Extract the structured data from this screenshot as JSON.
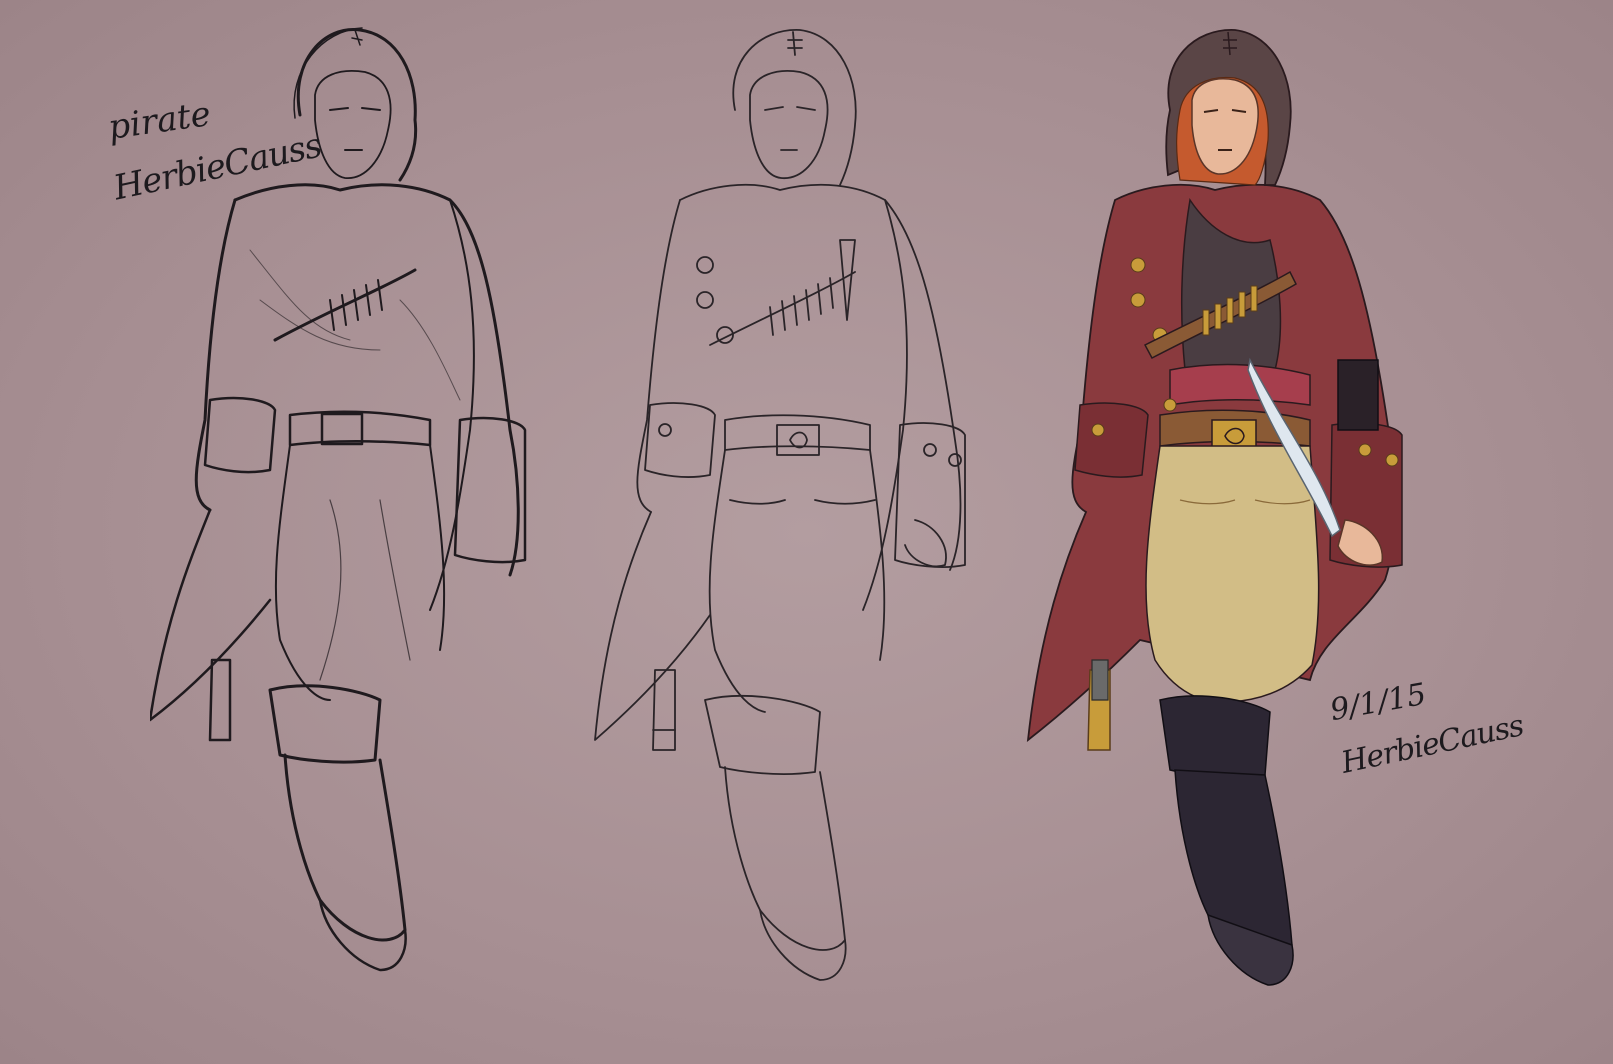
{
  "artwork": {
    "background_color": "#a8919a",
    "panels": [
      {
        "stage": "sketch",
        "stroke": "#1f1a1e"
      },
      {
        "stage": "lineart",
        "stroke": "#2a2428"
      },
      {
        "stage": "color",
        "palette": {
          "coat": "#8a3a3e",
          "pants": "#d2bd86",
          "boots": "#2c2633",
          "hood": "#5a4546",
          "hair": "#c55a2e",
          "sash": "#a63e4d",
          "belt": "#8a5a35",
          "gold": "#c89c3a",
          "blade": "#dfe7ef",
          "skin": "#e8b89a"
        }
      }
    ],
    "signature_1": {
      "line1": "pirate",
      "line2": "HerbieCauss"
    },
    "signature_2": {
      "date": "9/1/15",
      "name": "HerbieCauss"
    }
  }
}
